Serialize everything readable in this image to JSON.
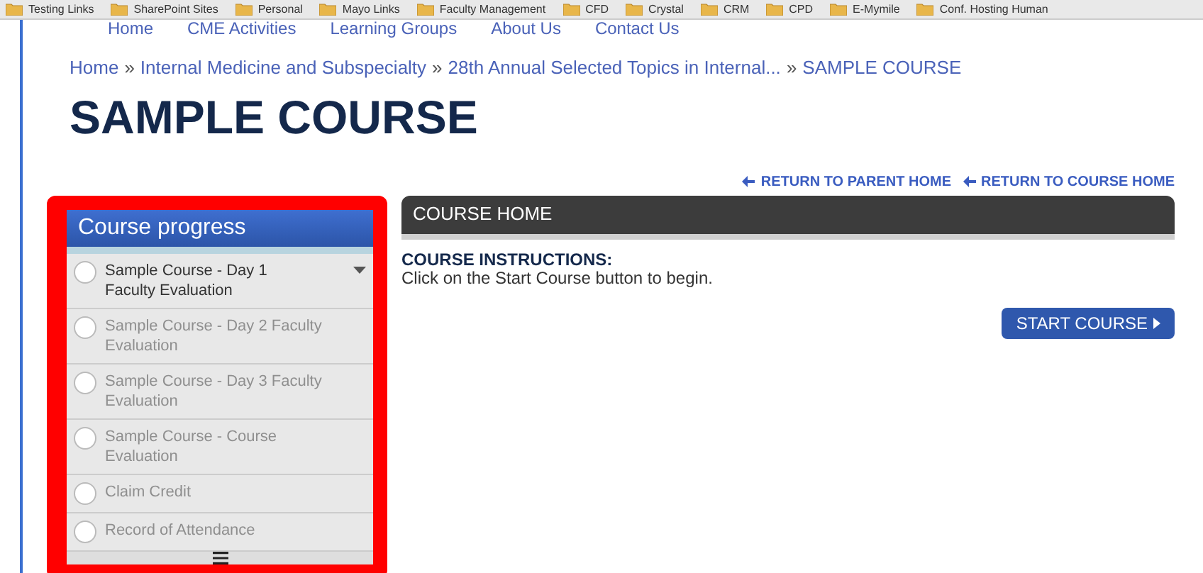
{
  "bookmarks": [
    "Testing Links",
    "SharePoint Sites",
    "Personal",
    "Mayo Links",
    "Faculty Management",
    "CFD",
    "Crystal",
    "CRM",
    "CPD",
    "E-Mymile",
    "Conf. Hosting Human"
  ],
  "nav": [
    "Home",
    "CME Activities",
    "Learning Groups",
    "About Us",
    "Contact Us"
  ],
  "breadcrumb_separator": "»",
  "breadcrumb": [
    "Home",
    "Internal Medicine and Subspecialty",
    "28th Annual Selected Topics in Internal...",
    "SAMPLE COURSE"
  ],
  "page_title": "SAMPLE COURSE",
  "return_links": [
    "RETURN TO PARENT HOME",
    "RETURN TO COURSE HOME"
  ],
  "sidebar": {
    "title": "Course progress",
    "highlighted": true,
    "items": [
      {
        "label": "Sample Course - Day 1 Faculty Evaluation",
        "disabled": false,
        "expandable": true
      },
      {
        "label": "Sample Course - Day 2 Faculty Evaluation",
        "disabled": true,
        "expandable": false
      },
      {
        "label": "Sample Course - Day 3 Faculty Evaluation",
        "disabled": true,
        "expandable": false
      },
      {
        "label": "Sample Course - Course Evaluation",
        "disabled": true,
        "expandable": false
      },
      {
        "label": "Claim Credit",
        "disabled": true,
        "expandable": false
      },
      {
        "label": "Record of Attendance",
        "disabled": true,
        "expandable": false
      }
    ]
  },
  "main": {
    "header": "COURSE HOME",
    "instructions_title": "COURSE INSTRUCTIONS:",
    "instructions": "Click on the Start Course button to begin.",
    "start_button": "START COURSE"
  }
}
